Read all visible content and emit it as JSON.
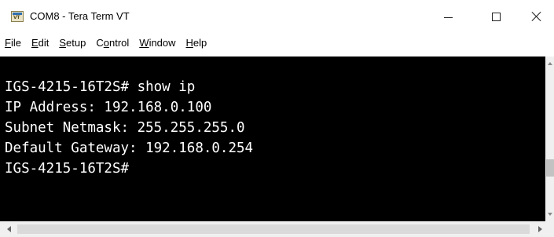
{
  "window": {
    "title": "COM8 - Tera Term VT",
    "icon": "tera-term-icon",
    "icon_text": "VT",
    "controls": {
      "minimize": "minimize-icon",
      "maximize": "maximize-icon",
      "close": "close-icon"
    }
  },
  "menu": [
    {
      "mnemonic": "F",
      "rest": "ile"
    },
    {
      "mnemonic": "E",
      "rest": "dit"
    },
    {
      "mnemonic": "S",
      "rest": "etup"
    },
    {
      "prefix": "C",
      "mnemonic": "o",
      "rest": "ntrol"
    },
    {
      "mnemonic": "W",
      "rest": "indow"
    },
    {
      "mnemonic": "H",
      "rest": "elp"
    }
  ],
  "terminal": {
    "background": "#000000",
    "foreground": "#ffffff",
    "lines": [
      "IGS-4215-16T2S# show ip",
      "IP Address: 192.168.0.100",
      "Subnet Netmask: 255.255.255.0",
      "Default Gateway: 192.168.0.254",
      "IGS-4215-16T2S#"
    ]
  }
}
